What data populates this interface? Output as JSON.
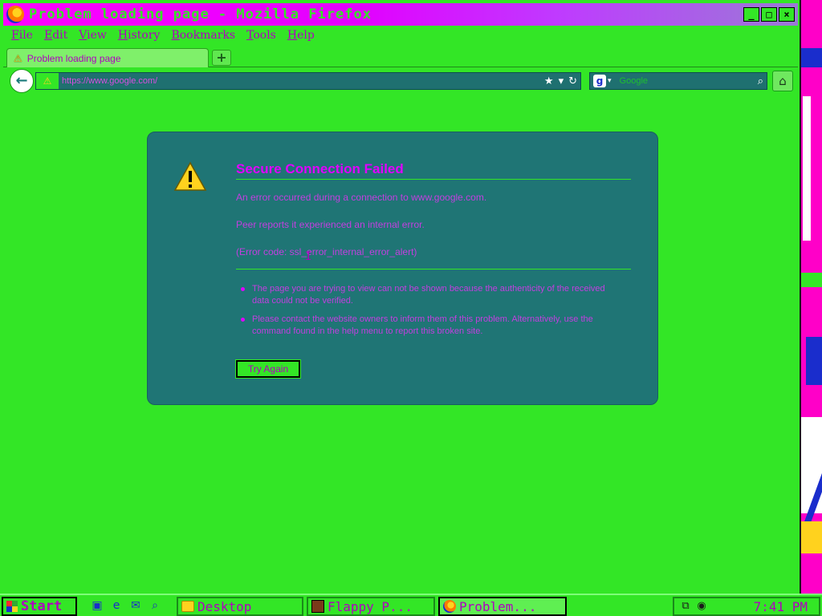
{
  "window": {
    "title": "Problem loading page - Mozilla Firefox",
    "controls": {
      "minimize": "_",
      "maximize": "□",
      "close": "×"
    }
  },
  "menu": [
    "File",
    "Edit",
    "View",
    "History",
    "Bookmarks",
    "Tools",
    "Help"
  ],
  "tab": {
    "label": "Problem loading page",
    "new_tab": "+"
  },
  "nav": {
    "back": "←",
    "url": "https://www.google.com/",
    "search_placeholder": "Google",
    "home": "⌂"
  },
  "error": {
    "title": "Secure Connection Failed",
    "line1": "An error occurred during a connection to www.google.com.",
    "line2": "Peer reports it experienced an internal error.",
    "line3": "(Error code: ssl_error_internal_error_alert)",
    "bullets": [
      "The page you are trying to view can not be shown because the authenticity of the received data could not be verified.",
      "Please contact the website owners to inform them of this problem. Alternatively, use the command found in the help menu to report this broken site."
    ],
    "button": "Try Again"
  },
  "taskbar": {
    "start": "Start",
    "tasks": [
      "Desktop",
      "Flappy P...",
      "Problem..."
    ],
    "clock": "7:41 PM"
  }
}
